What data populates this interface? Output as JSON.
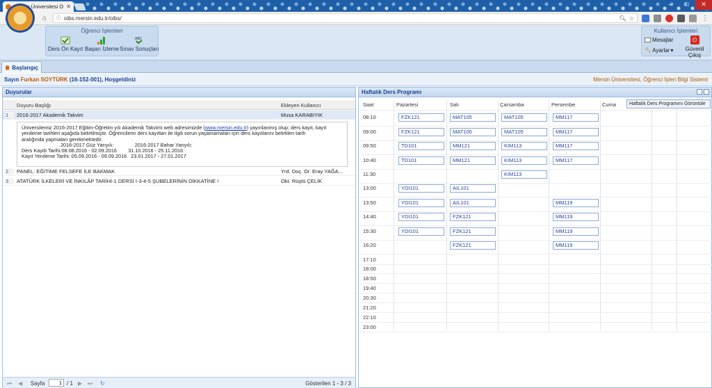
{
  "browser": {
    "tab_title": "Mersin Üniversitesi Öğr",
    "url": "oibs.mersin.edu.tr/oibs/"
  },
  "header": {
    "ogrenci_group": "Öğrenci İşlemleri",
    "buttons": [
      "Ders Ön Kayıt",
      "Başarı İzleme",
      "Sınav Sonuçları"
    ],
    "kullanici_group": "Kullanıcı İşlemleri",
    "mesajlar": "Mesajlar",
    "ayarlar": "Ayarlar",
    "cikis": "Güvenli Çıkış"
  },
  "start_tab": "Başlangıç",
  "welcome": {
    "prefix": "Sayın",
    "name": "Furkan SOYTÜRK",
    "suffix": "(16-152-001), Hoşgeldiniz",
    "system": "Mersin Üniversitesi, Öğrenci İşleri Bilgi Sistemi"
  },
  "announcements": {
    "title": "Duyurular",
    "col_title": "Duyuru Başlığı",
    "col_user": "Ekleyen Kullanıcı",
    "rows": [
      {
        "n": "1",
        "title": "2016-2017 Akademik Takvim",
        "user": "Musa KARABIYIK"
      },
      {
        "n": "2",
        "title": "PANEL: EĞİTİME FELSEFE İLE BAKMAK",
        "user": "Yrd. Doç. Dr. Eray YAĞA..."
      },
      {
        "n": "3",
        "title": "ATATÜRK İLKELERİ VE İNKILÂP TARİHİ-1 DERSİ I-3-4-5 ŞUBELERİNİN DİKKATİNE !",
        "user": "Okt. Rüştü ÇELİK"
      }
    ],
    "detail": {
      "line1_pre": "Üniversitemiz 2016-2017 Eğitim-Öğretim yılı Akademik Takvimi web adresimizde (",
      "link": "www.mersin.edu.tr",
      "line1_post": ") yayınlanmış olup; ders kayıt, kayıt",
      "line2": "yenileme tarihleri aşağıda belirtilmiştir.   Öğrencilerin ders kayıtları ile ilgili sorun yaşamamaları için ders kayıtlarını belirtilen tarih",
      "line3": "aralığında yapmaları gerekmektedir.",
      "line4": "2016-2017 Güz Yarıyılı:               2016-2017 Bahar Yarıyılı:",
      "line5": "Ders Kaydı Tarihi:08.08.2016 - 02.09.2016        31.10.2016 - 25.11.2016",
      "line6": "Kayıt Yenileme Tarihi: 05.09.2016 - 09.09.2016   23.01.2017 - 27.01.2017"
    },
    "pager": {
      "sayfa": "Sayfa",
      "page": "1",
      "of": "/ 1",
      "shown": "Gösterilen 1 - 3 / 3"
    }
  },
  "schedule": {
    "title": "Haftalık Ders Programı",
    "tooltip": "Haftalık Ders Programını Görüntüle",
    "headers": [
      "Saat",
      "Pazartesi",
      "Salı",
      "Çarsamba",
      "Persembe",
      "Cuma"
    ],
    "times": [
      "08:10",
      "09:00",
      "09:50",
      "10:40",
      "11:30",
      "13:00",
      "13:50",
      "14:40",
      "15:30",
      "16:20",
      "17:10",
      "18:00",
      "18:50",
      "19:40",
      "20:30",
      "21:20",
      "22:10",
      "23:00"
    ],
    "courses": [
      {
        "day": 0,
        "slot": 0,
        "code": "FZK121"
      },
      {
        "day": 1,
        "slot": 0,
        "code": "MAT105"
      },
      {
        "day": 2,
        "slot": 0,
        "code": "MAT105"
      },
      {
        "day": 3,
        "slot": 0,
        "code": "MM117"
      },
      {
        "day": 0,
        "slot": 1,
        "code": "FZK121"
      },
      {
        "day": 1,
        "slot": 1,
        "code": "MAT105"
      },
      {
        "day": 2,
        "slot": 1,
        "code": "MAT105"
      },
      {
        "day": 3,
        "slot": 1,
        "code": "MM117"
      },
      {
        "day": 0,
        "slot": 2,
        "code": "TD101"
      },
      {
        "day": 1,
        "slot": 2,
        "code": "MM121"
      },
      {
        "day": 2,
        "slot": 2,
        "code": "KIM113"
      },
      {
        "day": 3,
        "slot": 2,
        "code": "MM117"
      },
      {
        "day": 0,
        "slot": 3,
        "code": "TD101"
      },
      {
        "day": 1,
        "slot": 3,
        "code": "MM121"
      },
      {
        "day": 2,
        "slot": 3,
        "code": "KIM113"
      },
      {
        "day": 3,
        "slot": 3,
        "code": "MM117"
      },
      {
        "day": 2,
        "slot": 4,
        "code": "KIM113"
      },
      {
        "day": 0,
        "slot": 5,
        "code": "YDI101"
      },
      {
        "day": 1,
        "slot": 5,
        "code": "AIL101"
      },
      {
        "day": 0,
        "slot": 6,
        "code": "YDI101"
      },
      {
        "day": 1,
        "slot": 6,
        "code": "AIL101"
      },
      {
        "day": 3,
        "slot": 6,
        "code": "MM119"
      },
      {
        "day": 0,
        "slot": 7,
        "code": "YDI101"
      },
      {
        "day": 1,
        "slot": 7,
        "code": "FZK121"
      },
      {
        "day": 3,
        "slot": 7,
        "code": "MM119"
      },
      {
        "day": 0,
        "slot": 8,
        "code": "YDI101"
      },
      {
        "day": 1,
        "slot": 8,
        "code": "FZK121"
      },
      {
        "day": 3,
        "slot": 8,
        "code": "MM119"
      },
      {
        "day": 1,
        "slot": 9,
        "code": "FZK121"
      },
      {
        "day": 3,
        "slot": 9,
        "code": "MM119"
      }
    ]
  }
}
